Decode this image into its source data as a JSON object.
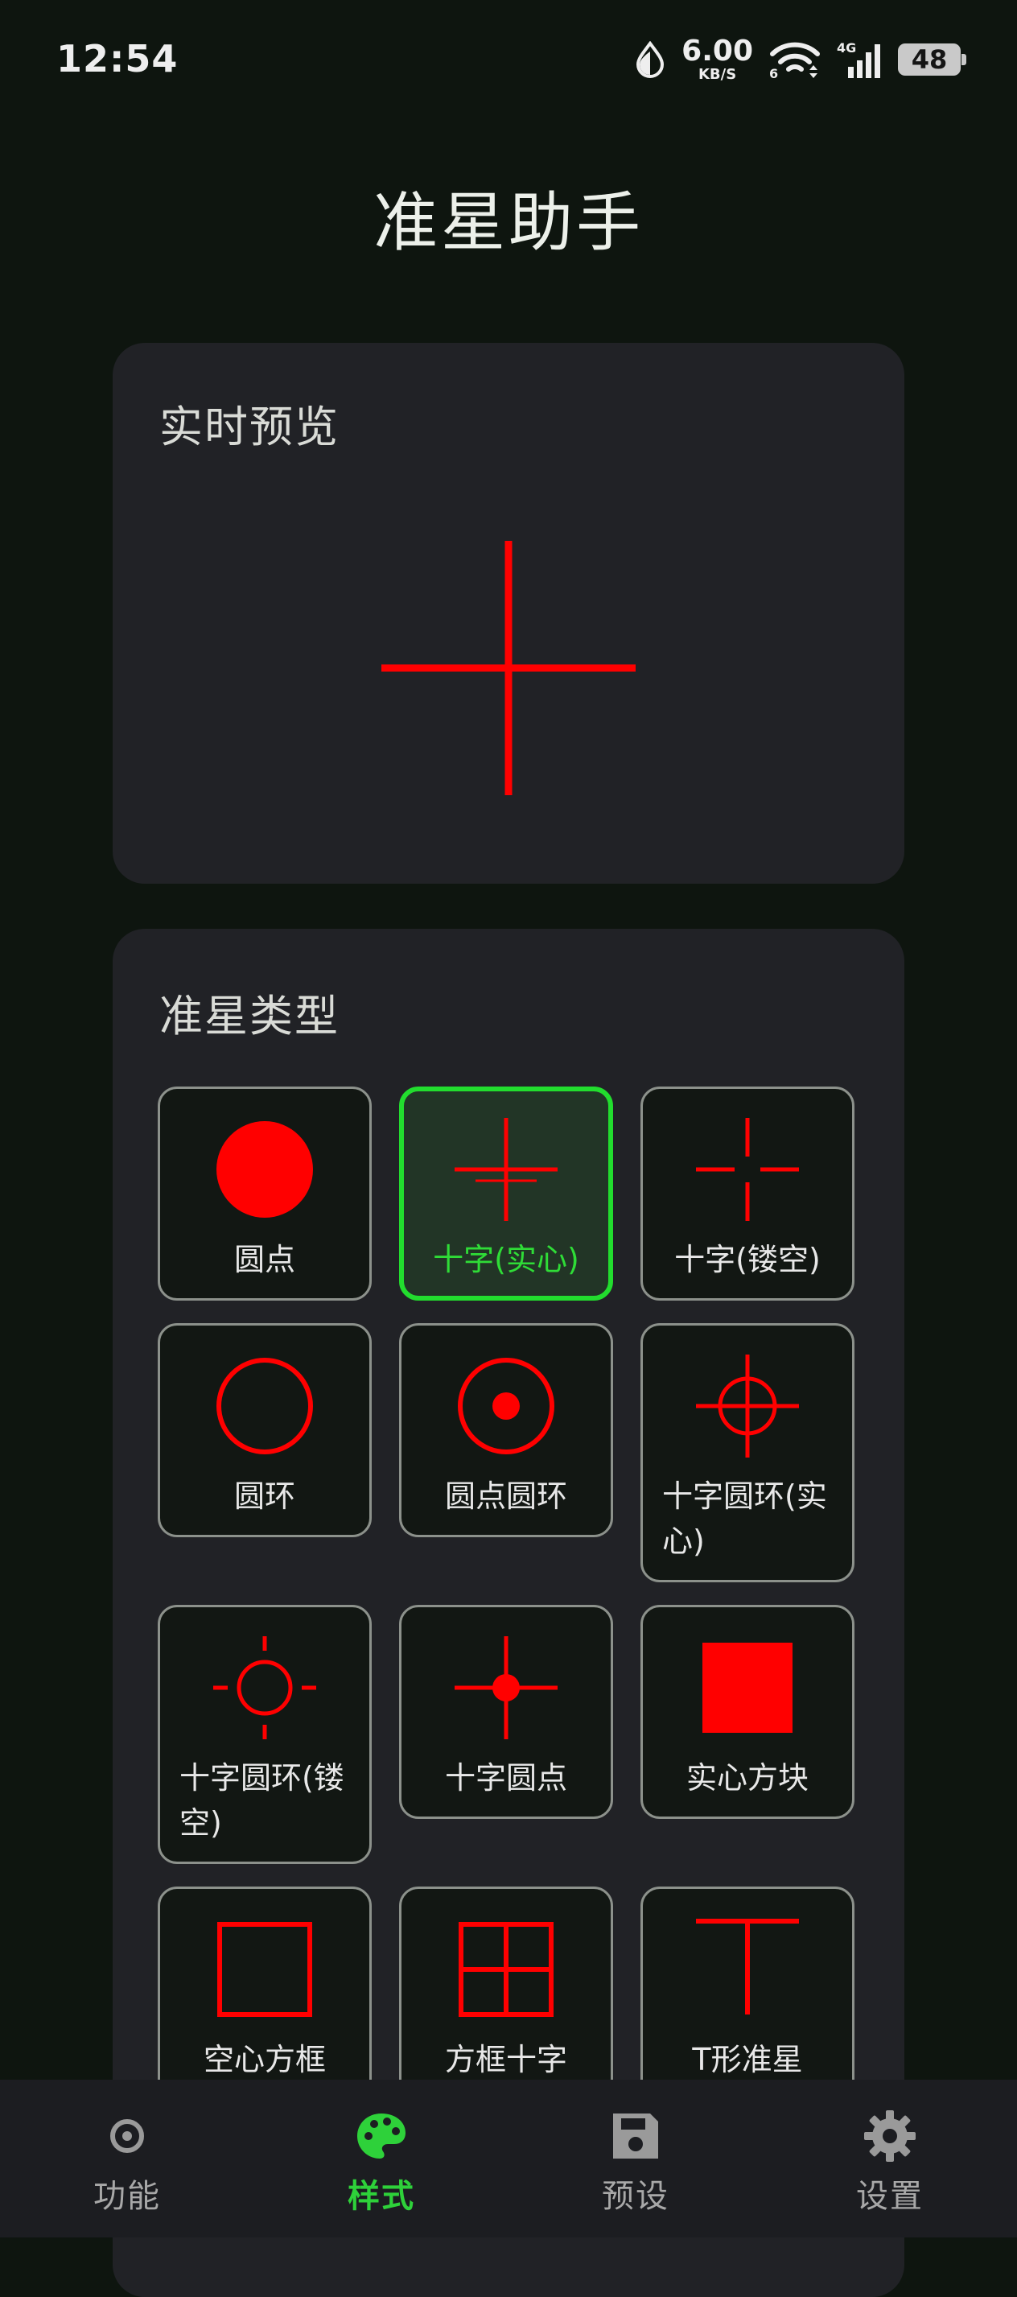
{
  "status_bar": {
    "time": "12:54",
    "net_speed": "6.00",
    "net_unit": "KB/S",
    "wifi_tag": "6",
    "cell_tag": "4G",
    "battery": "48"
  },
  "app_title": "准星助手",
  "preview": {
    "title": "实时预览",
    "crosshair_color": "#ff0000"
  },
  "types": {
    "title": "准星类型",
    "selected_index": 1,
    "accent_color": "#22dd2e",
    "items": [
      {
        "label": "圆点",
        "icon": "dot-icon"
      },
      {
        "label": "十字(实心)",
        "icon": "solid-cross-icon"
      },
      {
        "label": "十字(镂空)",
        "icon": "hollow-cross-icon"
      },
      {
        "label": "圆环",
        "icon": "ring-icon"
      },
      {
        "label": "圆点圆环",
        "icon": "dot-ring-icon"
      },
      {
        "label": "十字圆环(实心)",
        "icon": "cross-ring-solid-icon"
      },
      {
        "label": "十字圆环(镂空)",
        "icon": "cross-ring-hollow-icon"
      },
      {
        "label": "十字圆点",
        "icon": "cross-dot-icon"
      },
      {
        "label": "实心方块",
        "icon": "solid-square-icon"
      },
      {
        "label": "空心方框",
        "icon": "hollow-square-icon"
      },
      {
        "label": "方框十字",
        "icon": "square-cross-icon"
      },
      {
        "label": "T形准星",
        "icon": "t-shape-icon"
      }
    ]
  },
  "nav": {
    "active": "style",
    "items": [
      {
        "key": "functions",
        "label": "功能",
        "icon": "target-icon"
      },
      {
        "key": "style",
        "label": "样式",
        "icon": "palette-icon"
      },
      {
        "key": "presets",
        "label": "预设",
        "icon": "save-icon"
      },
      {
        "key": "settings",
        "label": "设置",
        "icon": "gear-icon"
      }
    ]
  }
}
